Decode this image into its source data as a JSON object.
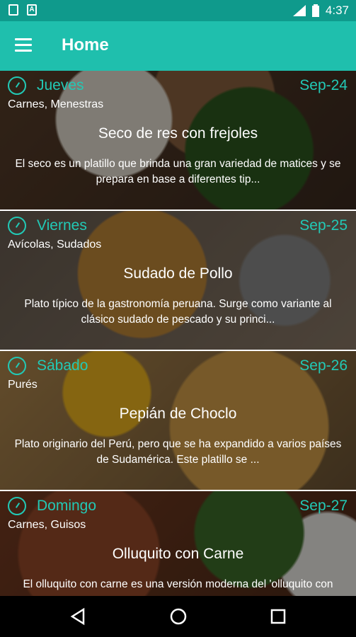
{
  "status": {
    "time": "4:37"
  },
  "appbar": {
    "title": "Home"
  },
  "cards": [
    {
      "day": "Jueves",
      "date": "Sep-24",
      "categories": "Carnes, Menestras",
      "title": "Seco de res con frejoles",
      "description": "El seco es un platillo que brinda una gran variedad de matices y se prepara en base a diferentes tip..."
    },
    {
      "day": "Viernes",
      "date": "Sep-25",
      "categories": "Avícolas, Sudados",
      "title": "Sudado de Pollo",
      "description": "Plato típico de la gastronomía peruana. Surge como variante al clásico sudado de pescado y su princi..."
    },
    {
      "day": "Sábado",
      "date": "Sep-26",
      "categories": "Purés",
      "title": "Pepián de Choclo",
      "description": "Plato originario del Perú, pero que se ha expandido a varios países de Sudamérica. Este platillo se ..."
    },
    {
      "day": "Domingo",
      "date": "Sep-27",
      "categories": "Carnes, Guisos",
      "title": "Olluquito con Carne",
      "description": "El olluquito con carne es una versión moderna del 'olluquito con"
    }
  ],
  "colors": {
    "accent": "#22c9b6",
    "appbar": "#1fbfad",
    "statusbar": "#0f9a8c"
  }
}
